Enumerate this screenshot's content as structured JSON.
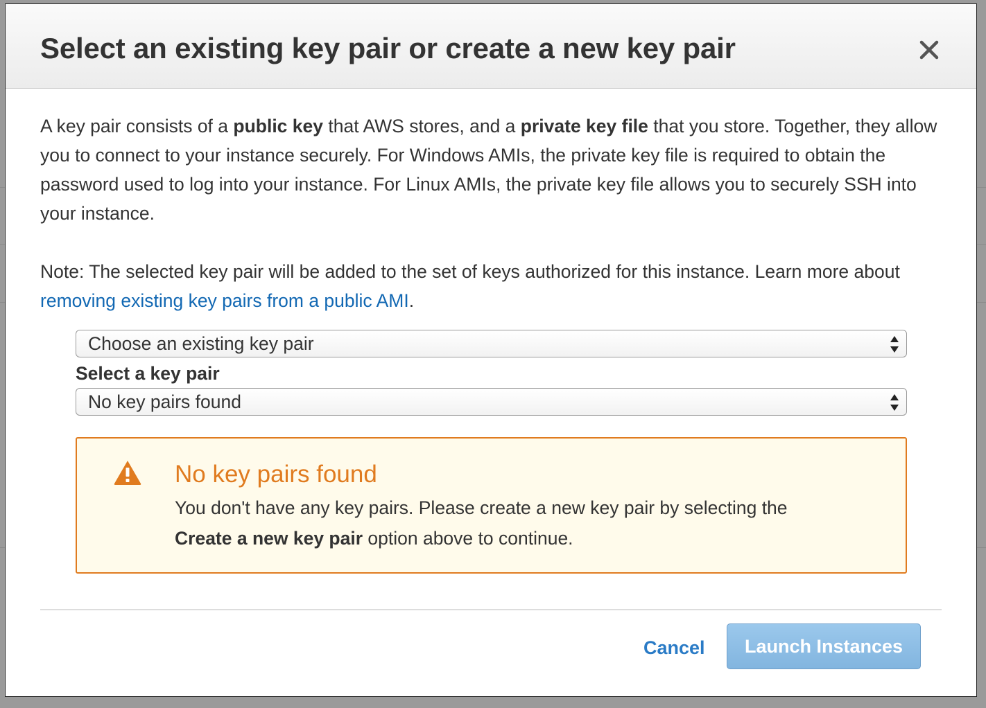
{
  "modal": {
    "title": "Select an existing key pair or create a new key pair",
    "close_icon": "close-icon"
  },
  "intro": {
    "t1": "A key pair consists of a ",
    "b1": "public key",
    "t2": " that AWS stores, and a ",
    "b2": "private key file",
    "t3": " that you store. Together, they allow you to connect to your instance securely. For Windows AMIs, the private key file is required to obtain the password used to log into your instance. For Linux AMIs, the private key file allows you to securely SSH into your instance."
  },
  "note": {
    "text": "Note: The selected key pair will be added to the set of keys authorized for this instance. Learn more about ",
    "link": "removing existing key pairs from a public AMI",
    "end": "."
  },
  "key_option_select": {
    "value": "Choose an existing key pair",
    "icon": "updown-arrows-icon"
  },
  "key_pair_select": {
    "label": "Select a key pair",
    "value": "No key pairs found",
    "icon": "updown-arrows-icon"
  },
  "alert": {
    "icon": "warning-icon",
    "title": "No key pairs found",
    "text1": "You don't have any key pairs. Please create a new key pair by selecting the ",
    "bold": "Create a new key pair",
    "text2": " option above to continue.",
    "color": "#e07b1f"
  },
  "footer": {
    "cancel_label": "Cancel",
    "launch_label": "Launch Instances"
  },
  "colors": {
    "link": "#1268b3",
    "primary_button": "#8dbde5",
    "warning": "#e07b1f",
    "warning_bg": "#fffbeb"
  }
}
